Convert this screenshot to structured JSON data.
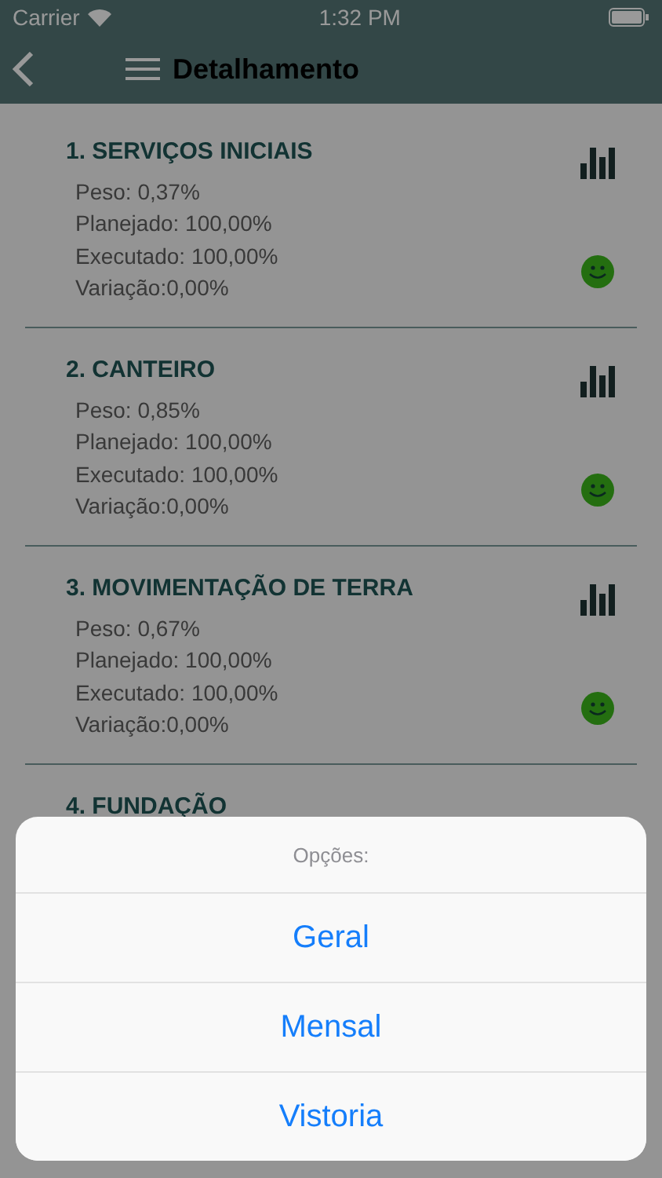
{
  "status_bar": {
    "carrier": "Carrier",
    "time": "1:32 PM"
  },
  "nav_bar": {
    "title": "Detalhamento"
  },
  "items": [
    {
      "title": "1. SERVIÇOS INICIAIS",
      "lines": [
        "Peso: 0,37%",
        "Planejado: 100,00%",
        "Executado: 100,00%",
        "Variação:0,00%"
      ],
      "icons": true
    },
    {
      "title": "2. CANTEIRO",
      "lines": [
        "Peso: 0,85%",
        "Planejado: 100,00%",
        "Executado: 100,00%",
        "Variação:0,00%"
      ],
      "icons": true
    },
    {
      "title": "3. MOVIMENTAÇÃO DE TERRA",
      "lines": [
        "Peso: 0,67%",
        "Planejado: 100,00%",
        "Executado: 100,00%",
        "Variação:0,00%"
      ],
      "icons": true
    },
    {
      "title": "4. FUNDAÇÃO",
      "icons": false
    }
  ],
  "action_sheet": {
    "title": "Opções:",
    "options": [
      "Geral",
      "Mensal",
      "Vistoria"
    ]
  }
}
